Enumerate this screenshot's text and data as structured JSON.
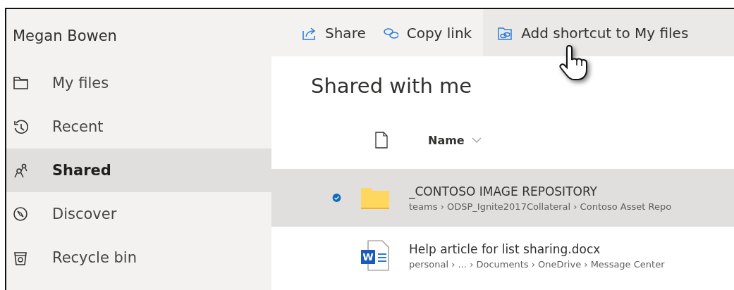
{
  "sidebar": {
    "user_name": "Megan Bowen",
    "items": [
      {
        "label": "My files",
        "selected": false
      },
      {
        "label": "Recent",
        "selected": false
      },
      {
        "label": "Shared",
        "selected": true
      },
      {
        "label": "Discover",
        "selected": false
      },
      {
        "label": "Recycle bin",
        "selected": false
      }
    ]
  },
  "toolbar": [
    {
      "label": "Share",
      "hovered": false
    },
    {
      "label": "Copy link",
      "hovered": false
    },
    {
      "label": "Add shortcut to My files",
      "hovered": true
    }
  ],
  "page_title": "Shared with me",
  "table": {
    "columns": [
      {
        "label": "Name",
        "sortable": true
      }
    ],
    "rows": [
      {
        "kind": "folder",
        "name": "_CONTOSO IMAGE REPOSITORY",
        "path": "teams › ODSP_Ignite2017Collateral › Contoso Asset Repo",
        "selected": true
      },
      {
        "kind": "word",
        "icon_letter": "W",
        "name": "Help article for list sharing.docx",
        "path": "personal › ... › Documents › OneDrive › Message Center",
        "selected": false
      }
    ]
  }
}
